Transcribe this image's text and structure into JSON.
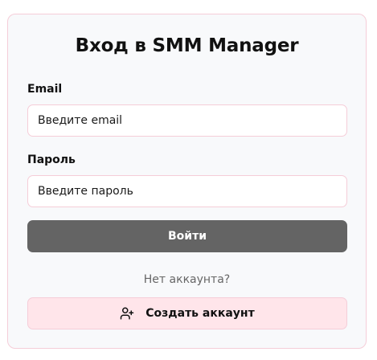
{
  "login_form": {
    "title": "Вход в SMM Manager",
    "email": {
      "label": "Email",
      "placeholder": "Введите email",
      "value": ""
    },
    "password": {
      "label": "Пароль",
      "placeholder": "Введите пароль",
      "value": ""
    },
    "login_button_label": "Войти",
    "no_account_text": "Нет аккаунта?",
    "create_account": {
      "label": "Создать аккаунт",
      "icon": "user-plus-icon"
    }
  },
  "colors": {
    "card_background": "#f8f9fb",
    "card_border": "#f5cdd8",
    "login_button": "#646464",
    "create_button_background": "#ffe5ea"
  }
}
